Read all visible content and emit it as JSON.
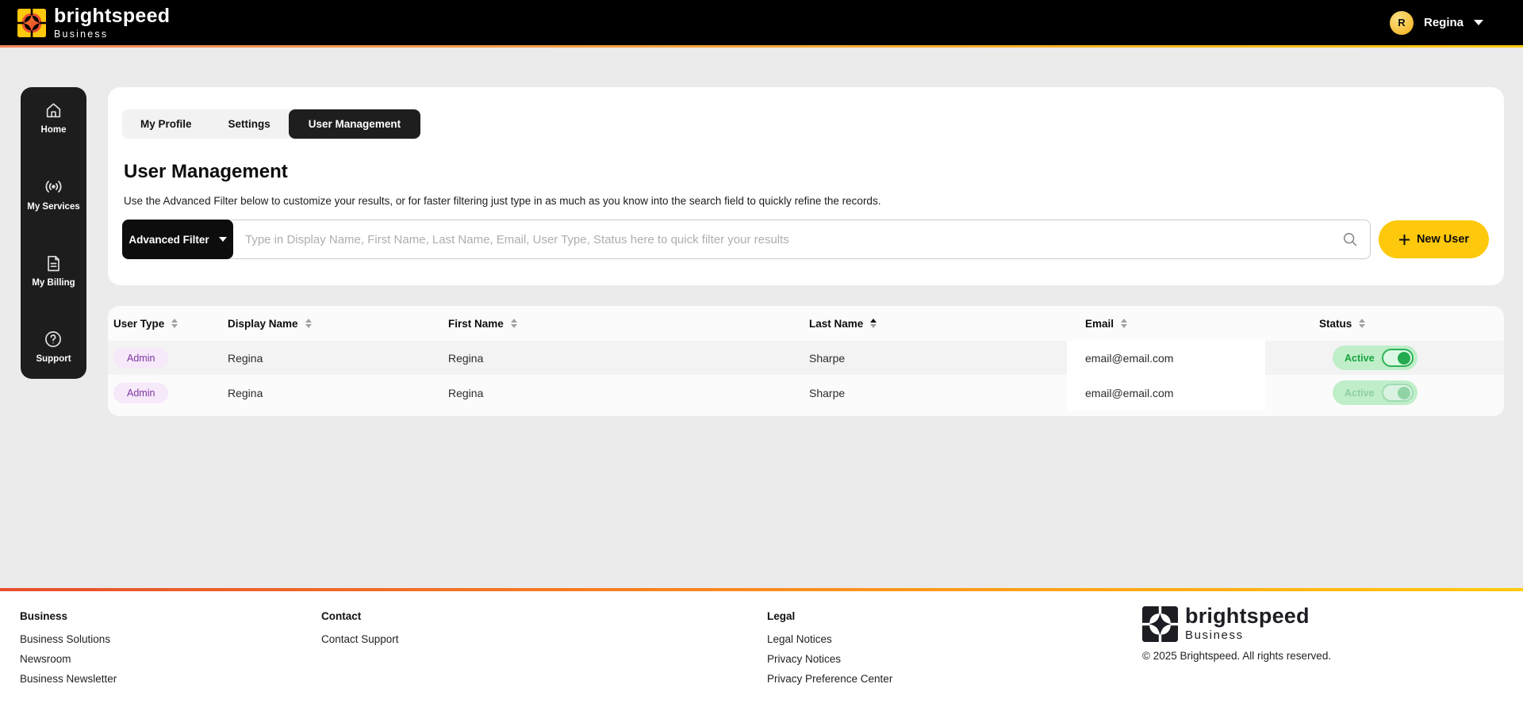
{
  "header": {
    "brand": "brightspeed",
    "brand_sub": "Business",
    "user_initial": "R",
    "user_name": "Regina"
  },
  "sidebar": {
    "items": [
      {
        "label": "Home",
        "icon": "home-icon"
      },
      {
        "label": "My Services",
        "icon": "broadcast-icon"
      },
      {
        "label": "My Billing",
        "icon": "document-icon"
      },
      {
        "label": "Support",
        "icon": "question-circle-icon"
      }
    ]
  },
  "tabs": [
    {
      "label": "My Profile",
      "active": false
    },
    {
      "label": "Settings",
      "active": false
    },
    {
      "label": "User Management",
      "active": true
    }
  ],
  "page": {
    "title": "User Management",
    "description": "Use the Advanced Filter below to customize your results, or for faster filtering just type in as much as you know into the search field to quickly refine the records."
  },
  "filter": {
    "advanced_filter_label": "Advanced Filter",
    "search_placeholder": "Type in Display Name, First Name, Last Name, Email, User Type, Status here to quick filter your results",
    "search_value": "",
    "new_user_label": "New User"
  },
  "table": {
    "columns": [
      "User Type",
      "Display Name",
      "First Name",
      "Last Name",
      "Email",
      "Status"
    ],
    "sorted_column": "Last Name",
    "sort_direction": "ascending",
    "rows": [
      {
        "user_type": "Admin",
        "display_name": "Regina",
        "first_name": "Regina",
        "last_name": "Sharpe",
        "email": "email@email.com",
        "status": "Active",
        "toggle_on": true,
        "muted": false
      },
      {
        "user_type": "Admin",
        "display_name": "Regina",
        "first_name": "Regina",
        "last_name": "Sharpe",
        "email": "email@email.com",
        "status": "Active",
        "toggle_on": true,
        "muted": true
      }
    ]
  },
  "footer": {
    "columns": [
      {
        "heading": "Business",
        "links": [
          "Business Solutions",
          "Newsroom",
          "Business Newsletter"
        ]
      },
      {
        "heading": "Contact",
        "links": [
          "Contact Support"
        ]
      },
      {
        "heading": "Legal",
        "links": [
          "Legal Notices",
          "Privacy Notices",
          "Privacy Preference Center"
        ]
      }
    ],
    "brand": "brightspeed",
    "brand_sub": "Business",
    "copyright": "© 2025 Brightspeed. All rights reserved."
  },
  "colors": {
    "accent_yellow": "#FEC80C",
    "header_black": "#000000",
    "admin_badge_bg": "#F6E9F9",
    "admin_badge_text": "#7C35A0",
    "status_pill_bg": "#BFEEC9",
    "status_active_green": "#17A340",
    "gradient_left": "#E84E2D"
  }
}
